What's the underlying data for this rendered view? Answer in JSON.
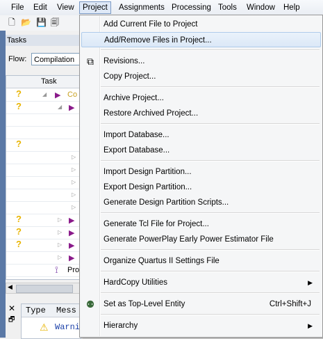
{
  "menubar": {
    "items": [
      "File",
      "Edit",
      "View",
      "Project",
      "Assignments",
      "Processing",
      "Tools",
      "Window",
      "Help"
    ]
  },
  "tasks_panel": {
    "title": "Tasks",
    "flow_label": "Flow:",
    "flow_value": "Compilation",
    "column_task": "Task",
    "row1_text": "Co",
    "last_row_text": "Pro"
  },
  "messages_panel": {
    "col_type": "Type",
    "col_message": "Mess",
    "warning_text": "Warni"
  },
  "project_menu": {
    "items": [
      {
        "label": "Add Current File to Project"
      },
      {
        "label": "Add/Remove Files in Project..."
      },
      {
        "label": "Revisions..."
      },
      {
        "label": "Copy Project..."
      },
      {
        "label": "Archive Project..."
      },
      {
        "label": "Restore Archived Project..."
      },
      {
        "label": "Import Database..."
      },
      {
        "label": "Export Database..."
      },
      {
        "label": "Import Design Partition..."
      },
      {
        "label": "Export Design Partition..."
      },
      {
        "label": "Generate Design Partition Scripts..."
      },
      {
        "label": "Generate Tcl File for Project..."
      },
      {
        "label": "Generate PowerPlay Early Power Estimator File"
      },
      {
        "label": "Organize Quartus II Settings File"
      },
      {
        "label": "HardCopy Utilities"
      },
      {
        "label": "Set as Top-Level Entity",
        "shortcut": "Ctrl+Shift+J"
      },
      {
        "label": "Hierarchy"
      }
    ]
  }
}
